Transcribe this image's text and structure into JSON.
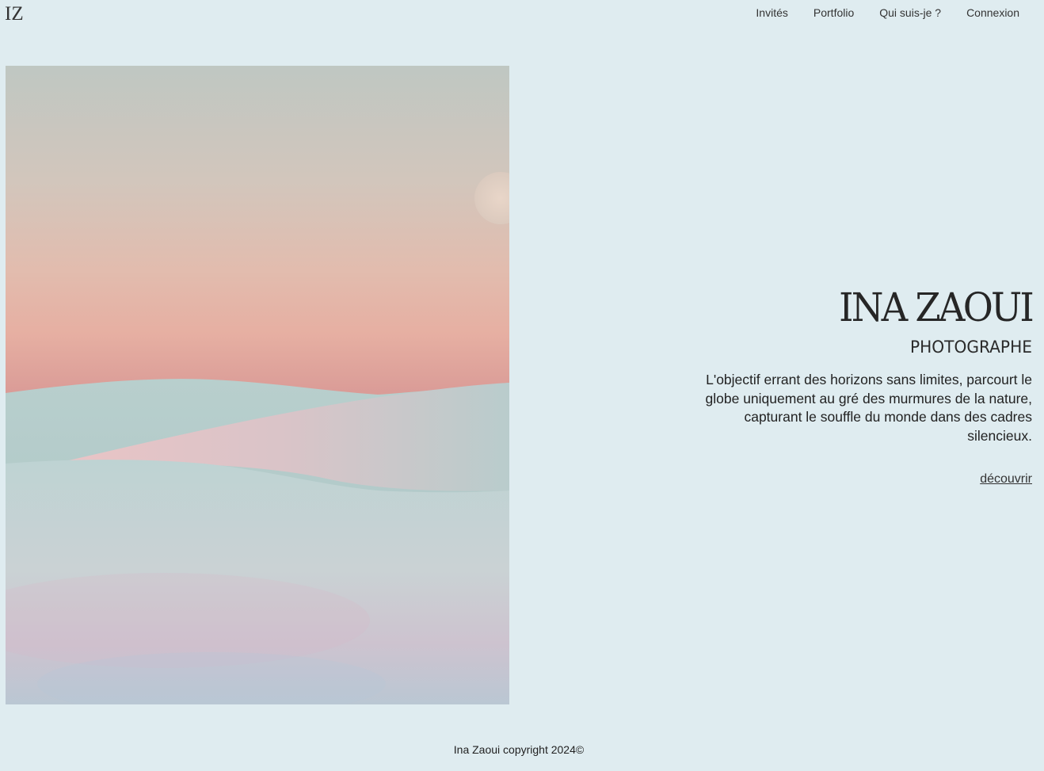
{
  "header": {
    "logo": "IZ",
    "nav": [
      {
        "label": "Invités"
      },
      {
        "label": "Portfolio"
      },
      {
        "label": "Qui suis-je ?"
      },
      {
        "label": "Connexion"
      }
    ]
  },
  "hero": {
    "name": "INA ZAOUI",
    "role": "PHOTOGRAPHE",
    "description": "L'objectif errant des horizons sans limites, parcourt le globe uniquement au gré des murmures de la nature, capturant le souffle du monde dans des cadres silencieux.",
    "cta": "découvrir"
  },
  "footer": {
    "copyright": "Ina Zaoui copyright 2024©"
  },
  "colors": {
    "background": "#dfecf0",
    "sky_top": "#c2c8c3",
    "sky_pink": "#e6b0a6",
    "dune": "#b7cccc"
  }
}
